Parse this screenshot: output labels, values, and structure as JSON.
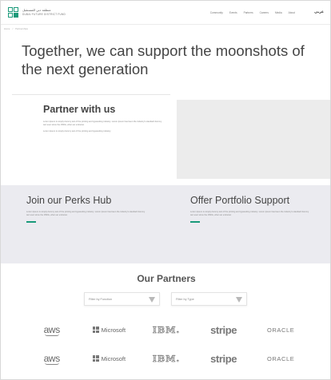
{
  "header": {
    "logo_ar": "منطقة دبي للمستقبل",
    "logo_en": "DUBAI FUTURE DISTRICT FUND",
    "nav": [
      "Community",
      "Events",
      "Partners",
      "Careers",
      "Media",
      "About"
    ],
    "lang_label": "عربي"
  },
  "breadcrumb": [
    "Home",
    "/",
    "Partnerships"
  ],
  "hero": {
    "title": "Together, we can support the moonshots of the next generation"
  },
  "partner_with_us": {
    "title": "Partner with us",
    "body": "Lorem Ipsum is simply dummy text of the printing and typesetting industry. Lorem Ipsum has been the industry's standard dummy text ever since the 1500s, when an unknown",
    "body2": "Lorem Ipsum is simply dummy text of the printing and typesetting industry."
  },
  "perks": {
    "title": "Join our Perks Hub",
    "body": "Lorem Ipsum is simply dummy text of the printing and typesetting industry. Lorem Ipsum has been the industry's standard dummy text ever since the 1500s, when an unknown"
  },
  "portfolio": {
    "title": "Offer Portfolio Support",
    "body": "Lorem Ipsum is simply dummy text of the printing and typesetting industry. Lorem Ipsum has been the industry's standard dummy text ever since the 1500s, when an unknown"
  },
  "partners": {
    "title": "Our Partners",
    "filter_function": "Filter by Function",
    "filter_type": "Filter by Type",
    "logos": [
      {
        "name": "aws",
        "label": "aws"
      },
      {
        "name": "microsoft",
        "label": "Microsoft"
      },
      {
        "name": "ibm",
        "label": "IBM."
      },
      {
        "name": "stripe",
        "label": "stripe"
      },
      {
        "name": "oracle",
        "label": "ORACLE"
      },
      {
        "name": "aws",
        "label": "aws"
      },
      {
        "name": "microsoft",
        "label": "Microsoft"
      },
      {
        "name": "ibm",
        "label": "IBM."
      },
      {
        "name": "stripe",
        "label": "stripe"
      },
      {
        "name": "oracle",
        "label": "ORACLE"
      }
    ]
  },
  "colors": {
    "accent": "#1a9a7a",
    "band_bg": "#ebebf0",
    "image_placeholder": "#ececec"
  }
}
